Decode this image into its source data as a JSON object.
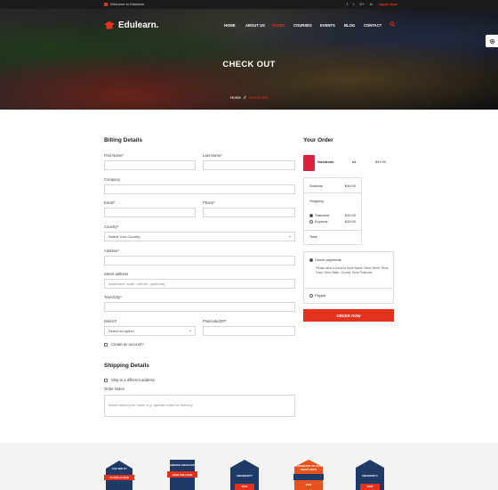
{
  "topbar": {
    "welcome": "Welcome to Edulearn",
    "socials": [
      "f",
      "t",
      "G+",
      "in"
    ],
    "apply": "Apply Now"
  },
  "header": {
    "logo": "Edulearn.",
    "nav": [
      "HOME",
      "ABOUT US",
      "PAGES",
      "COURSES",
      "EVENTS",
      "BLOG",
      "CONTACT"
    ],
    "active_nav": "PAGES"
  },
  "hero": {
    "title": "CHECK OUT",
    "crumb_home": "Home",
    "crumb_sep": "//",
    "crumb_current": "Check Out"
  },
  "billing": {
    "title": "Billing Details",
    "first_name": "First Name*",
    "last_name": "Last Name*",
    "company": "Company",
    "email": "Email*",
    "phone": "Phone*",
    "country": "Country*",
    "country_value": "Select Your Country",
    "address": "Address*",
    "street": "Street address",
    "street_placeholder": "Apartment, suite, unit etc. (optional)",
    "town": "Town/City*",
    "district": "District*",
    "district_value": "Select an option",
    "postcode": "Postcode/ZIP*",
    "create_account": "Create an account?"
  },
  "shipping": {
    "title": "Shipping Details",
    "ship_different": "Ship to a different address",
    "order_notes": "Order Notes",
    "notes_placeholder": "Notes about your order, e.g. special notes for delivery."
  },
  "order": {
    "title": "Your Order",
    "item_name": "Notebook",
    "item_qty": "x1",
    "item_price": "$49.00",
    "subtotal_label": "Subtotal",
    "subtotal_value": "$49.00",
    "shipping_label": "Shipping",
    "standard_label": "Standard",
    "standard_value": "$10.00",
    "express_label": "Express",
    "express_value": "$15.00",
    "total_label": "Total",
    "check_payments": "Check payments",
    "payment_note": "Please send a check to Store Name, Store Street, Store Town, Store State / County, Store Postcode.",
    "paypal": "Paypal",
    "button": "ORDER NOW"
  },
  "badges": [
    {
      "top": "YOU DID IT!",
      "bottom": "CLASS of 2016"
    },
    {
      "top": "SCIENCE GRADUATE",
      "bottom": "HIGH COLLEGE"
    },
    {
      "top": "UNIVERSITY",
      "bottom": "2016"
    },
    {
      "top": "CONGRATS TO OUR GRADUATES",
      "bottom": "2016"
    },
    {
      "top": "UNIVERSITY",
      "bottom": "2016"
    }
  ],
  "colors": {
    "accent": "#e5321d",
    "dark": "#1b1b1b",
    "navy": "#1f3a66"
  }
}
